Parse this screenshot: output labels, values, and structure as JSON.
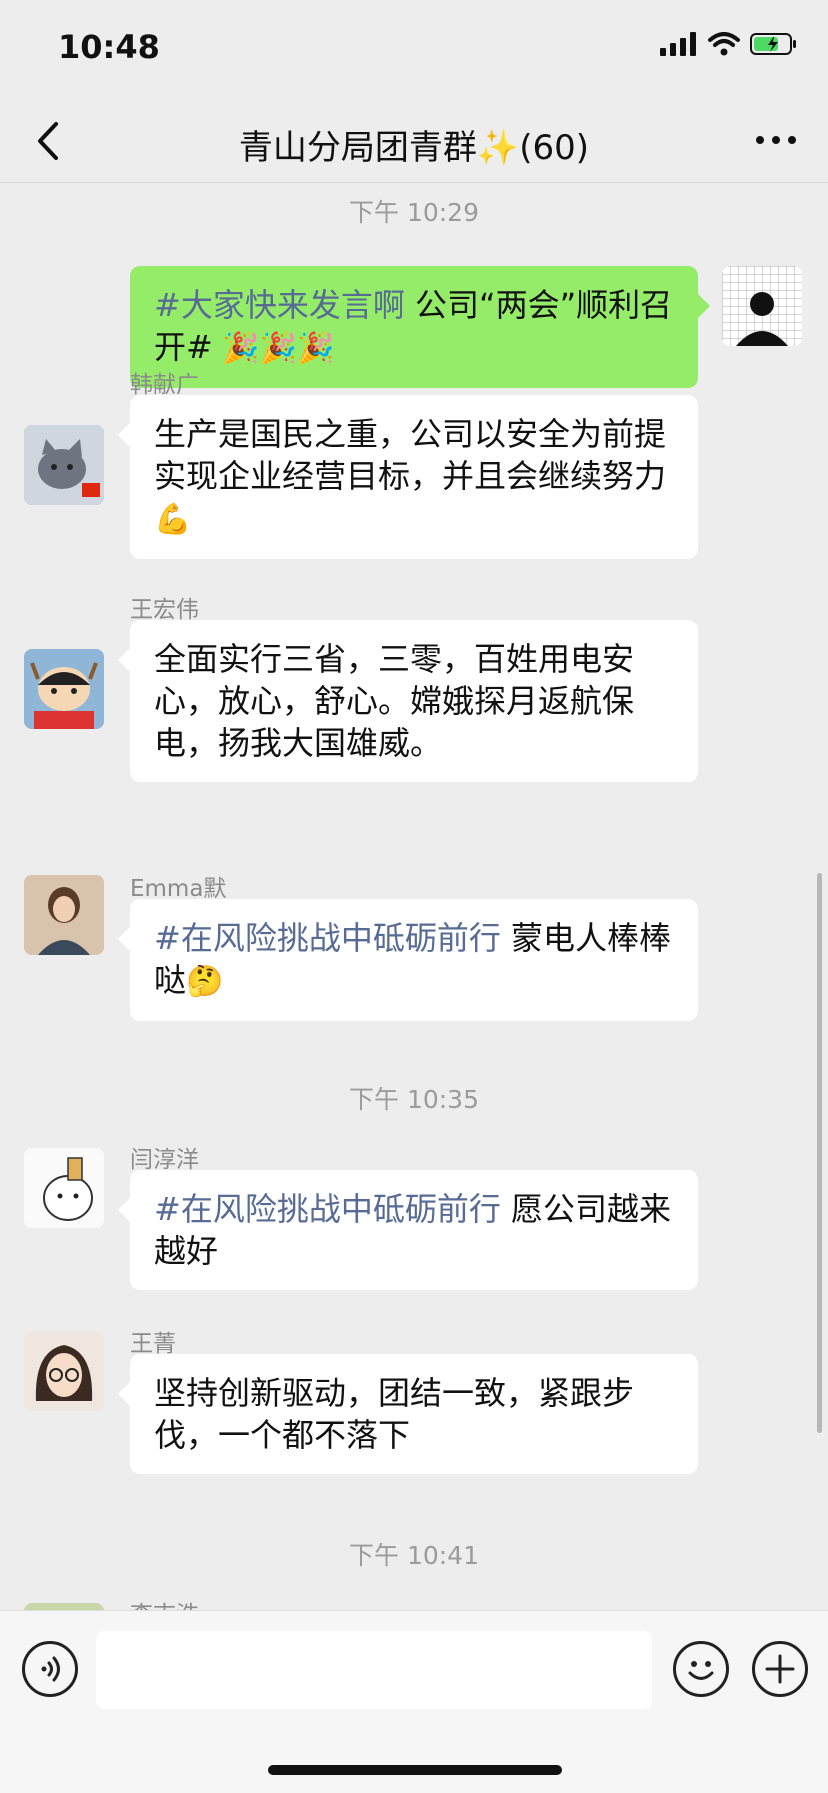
{
  "status": {
    "time": "10:48"
  },
  "header": {
    "title": "青山分局团青群✨(60)"
  },
  "timestamps": [
    "下午 10:29",
    "下午 10:35",
    "下午 10:41"
  ],
  "messages": [
    {
      "sender": "",
      "mine": true,
      "tag": "#大家快来发言啊",
      "text": " 公司“两会”顺利召开#",
      "emoji": " 🎉🎉🎉"
    },
    {
      "sender": "韩献广",
      "text": "生产是国民之重，公司以安全为前提实现企业经营目标，并且会继续努力",
      "emoji": "💪"
    },
    {
      "sender": "王宏伟",
      "text": " 全面实行三省，三零，百姓用电安心，放心，舒心。嫦娥探月返航保电，扬我大国雄威。"
    },
    {
      "sender": "Emma默",
      "tag": "#在风险挑战中砥砺前行",
      "text": " 蒙电人棒棒哒",
      "emoji": "🤔"
    },
    {
      "sender": "闫淳洋",
      "tag": "#在风险挑战中砥砺前行",
      "text": " 愿公司越来越好"
    },
    {
      "sender": "王菁",
      "text": "坚持创新驱动，团结一致，紧跟步伐，一个都不落下"
    },
    {
      "sender": "李志浩"
    }
  ],
  "colors": {
    "my_bubble": "#95ec69",
    "tag": "#576b95"
  }
}
